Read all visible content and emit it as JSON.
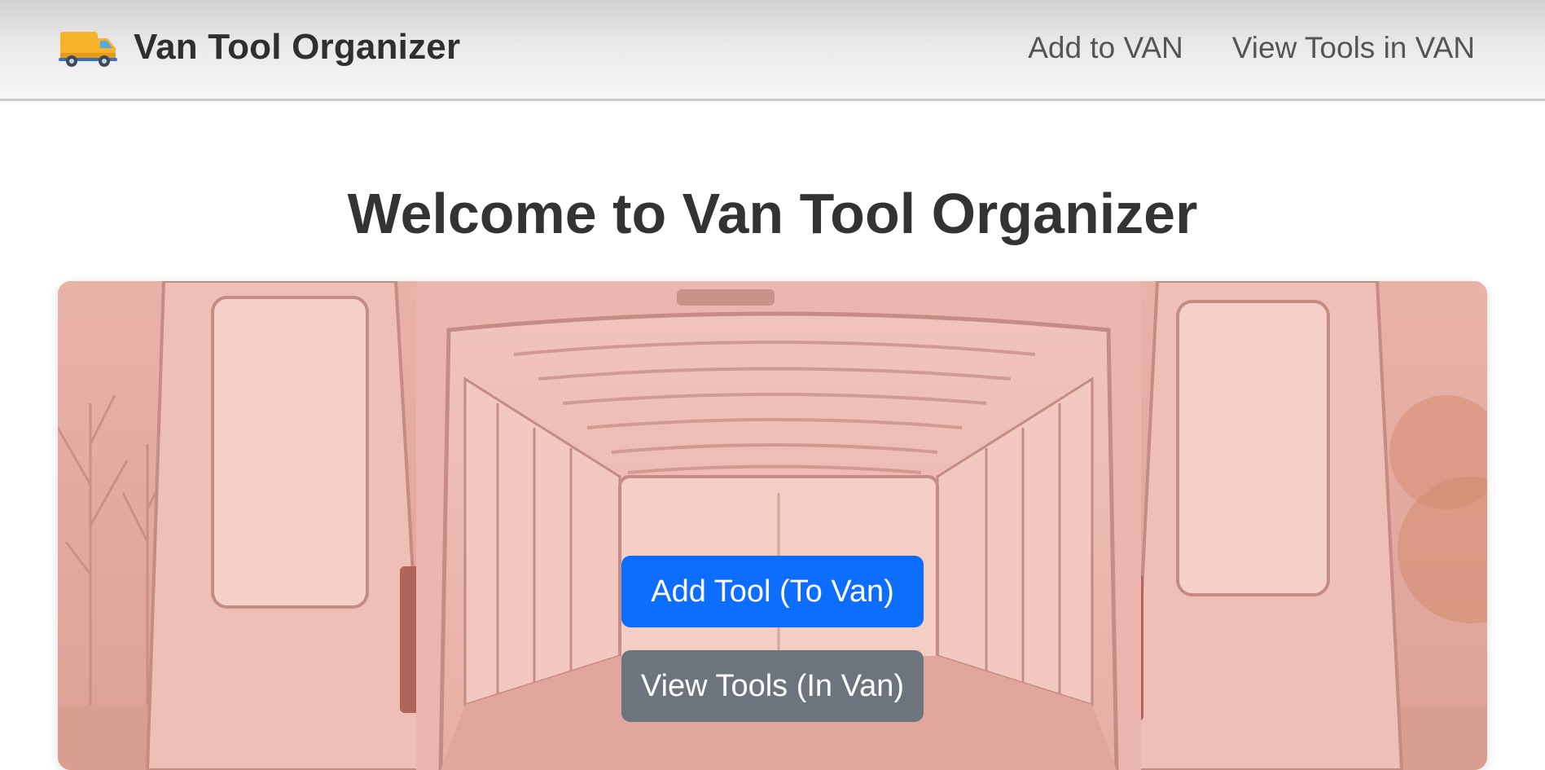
{
  "header": {
    "brand_icon": "van-icon",
    "brand_title": "Van Tool Organizer",
    "nav": [
      {
        "label": "Add to VAN"
      },
      {
        "label": "View Tools in VAN"
      }
    ]
  },
  "main": {
    "title": "Welcome to Van Tool Organizer",
    "hero_image": "van-interior-image",
    "buttons": {
      "add_tool": "Add Tool (To Van)",
      "view_tools": "View Tools (In Van)"
    }
  },
  "colors": {
    "primary": "#0d6efd",
    "secondary": "#6c757d",
    "hero_tint": "#e8aea4"
  }
}
